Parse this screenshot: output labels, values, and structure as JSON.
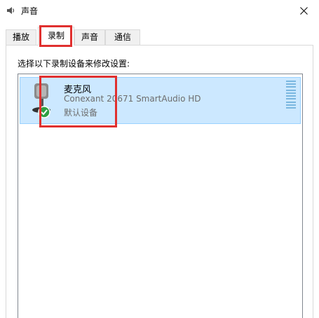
{
  "window": {
    "title": "声音",
    "app_icon": "speaker-icon",
    "close_icon": "close-icon"
  },
  "tabs": [
    {
      "label": "播放",
      "selected": false
    },
    {
      "label": "录制",
      "selected": true
    },
    {
      "label": "声音",
      "selected": false
    },
    {
      "label": "通信",
      "selected": false
    }
  ],
  "panel": {
    "instruction": "选择以下录制设备来修改设置:",
    "devices": [
      {
        "name": "麦克风",
        "detail": "Conexant 20671 SmartAudio HD",
        "status": "默认设备",
        "icon": "microphone-icon",
        "badge_icon": "default-check-icon",
        "selected": true
      }
    ]
  },
  "colors": {
    "selection_bg": "#cce8ff",
    "selection_border": "#99d1ff",
    "annotation_red": "#e0302f",
    "check_green": "#2ea043"
  }
}
